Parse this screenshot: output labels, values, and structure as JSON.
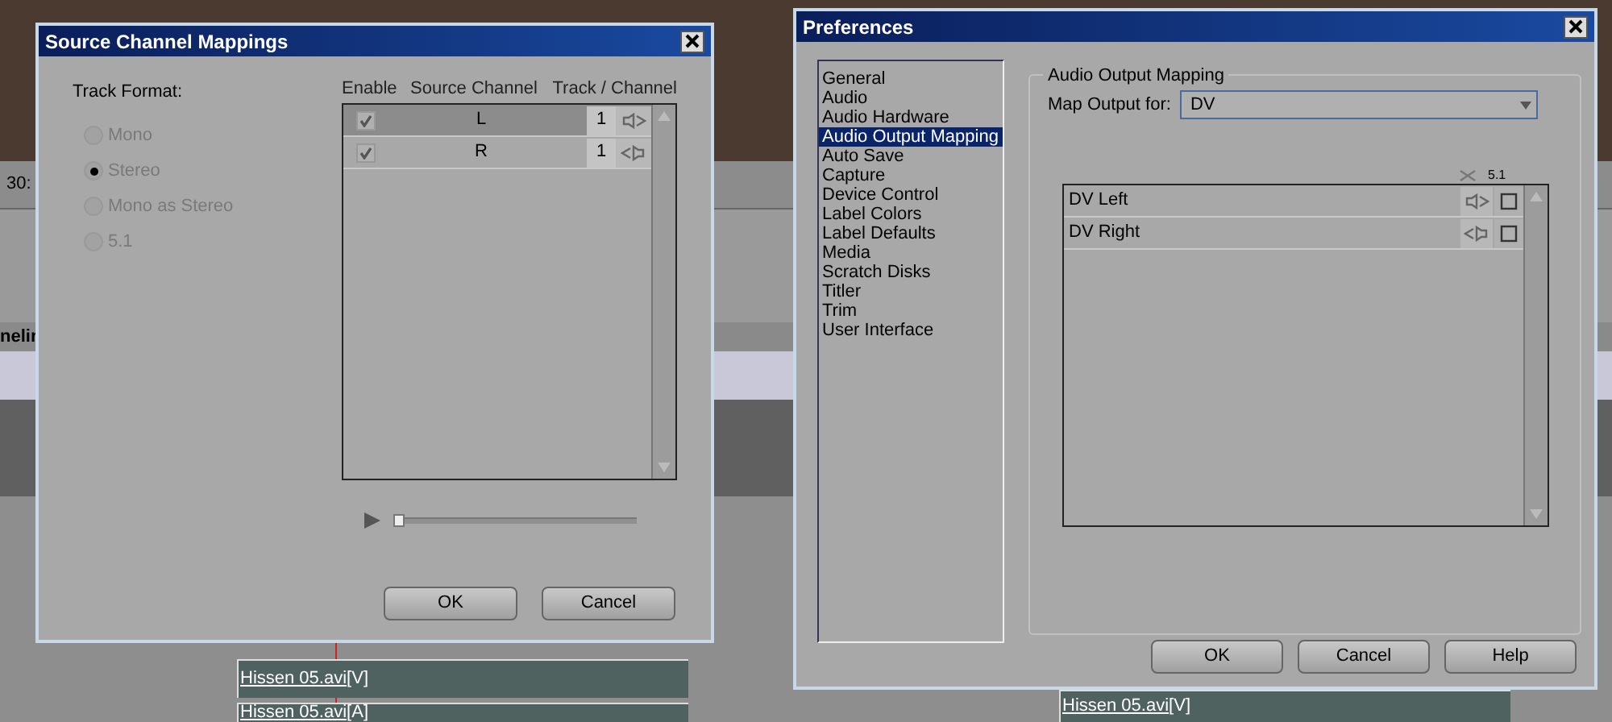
{
  "background": {
    "texts": [
      {
        "text": "30:"
      },
      {
        "text": "nelir"
      }
    ],
    "clips": [
      {
        "label": "Hissen 05.avi",
        "track": "[V]"
      },
      {
        "label": "Hissen 05.avi",
        "track": "[A]"
      },
      {
        "label": "Hissen 05.avi",
        "track": "[V]"
      }
    ]
  },
  "source_dialog": {
    "title": "Source Channel Mappings",
    "format_label": "Track Format:",
    "formats": [
      {
        "label": "Mono",
        "selected": false
      },
      {
        "label": "Stereo",
        "selected": true
      },
      {
        "label": "Mono as Stereo",
        "selected": false
      },
      {
        "label": "5.1",
        "selected": false
      }
    ],
    "columns": [
      "Enable",
      "Source Channel",
      "Track / Channel"
    ],
    "channels": [
      {
        "enabled": true,
        "channel": "L",
        "track": "1",
        "selected": true,
        "kind": "left"
      },
      {
        "enabled": true,
        "channel": "R",
        "track": "1",
        "selected": false,
        "kind": "right"
      }
    ],
    "slider": {
      "level": 0
    },
    "buttons": [
      "OK",
      "Cancel"
    ]
  },
  "preferences": {
    "title": "Preferences",
    "categories": [
      {
        "label": "General",
        "selected": false
      },
      {
        "label": "Audio",
        "selected": false
      },
      {
        "label": "Audio Hardware",
        "selected": false
      },
      {
        "label": "Audio Output Mapping",
        "selected": true
      },
      {
        "label": "Auto Save",
        "selected": false
      },
      {
        "label": "Capture",
        "selected": false
      },
      {
        "label": "Device Control",
        "selected": false
      },
      {
        "label": "Label Colors",
        "selected": false
      },
      {
        "label": "Label Defaults",
        "selected": false
      },
      {
        "label": "Media",
        "selected": false
      },
      {
        "label": "Scratch Disks",
        "selected": false
      },
      {
        "label": "Titler",
        "selected": false
      },
      {
        "label": "Trim",
        "selected": false
      },
      {
        "label": "User Interface",
        "selected": false
      }
    ],
    "group_title": "Audio Output Mapping",
    "map_label": "Map Output for:",
    "map_value": "DV",
    "surround_header": "5.1",
    "outputs": [
      {
        "name": "DV Left",
        "kind": "left"
      },
      {
        "name": "DV Right",
        "kind": "right"
      }
    ],
    "buttons": [
      "OK",
      "Cancel",
      "Help"
    ]
  }
}
